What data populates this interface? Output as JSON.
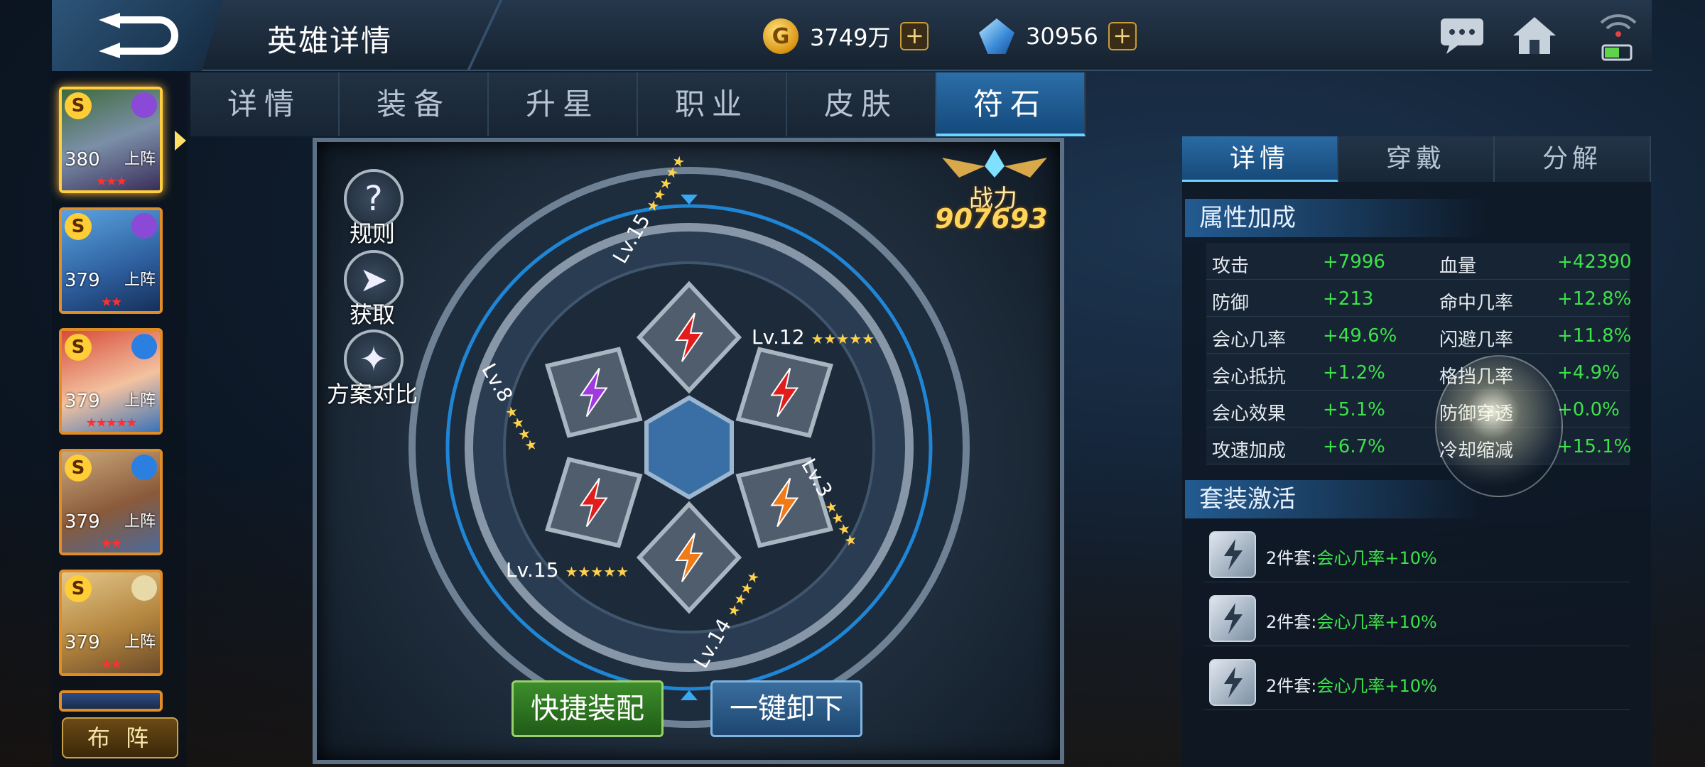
{
  "header": {
    "title": "英雄详情",
    "gold": "3749万",
    "gems": "30956"
  },
  "tabs": [
    "详情",
    "装备",
    "升星",
    "职业",
    "皮肤",
    "符石"
  ],
  "heroes": [
    {
      "grade": "S",
      "level": "380",
      "status": "上阵",
      "stars": "★★★",
      "element": "#8a49d6"
    },
    {
      "grade": "S",
      "level": "379",
      "status": "上阵",
      "stars": "★★",
      "element": "#8a49d6"
    },
    {
      "grade": "S",
      "level": "379",
      "status": "上阵",
      "stars": "★★★★★",
      "element": "#2a7fe0"
    },
    {
      "grade": "S",
      "level": "379",
      "status": "上阵",
      "stars": "★★",
      "element": "#2a7fe0"
    },
    {
      "grade": "S",
      "level": "379",
      "status": "上阵",
      "stars": "★★",
      "element": "#e8d9a8"
    }
  ],
  "formation_label": "布 阵",
  "side_buttons": {
    "rules": "规则",
    "obtain": "获取",
    "compare": "方案对比"
  },
  "power": {
    "label": "战力",
    "value": "907693"
  },
  "runes": [
    {
      "level": "Lv.15",
      "stars": "★★★★★",
      "color": "#e21b1b"
    },
    {
      "level": "Lv.12",
      "stars": "★★★★★",
      "color": "#e21b1b"
    },
    {
      "level": "Lv.3",
      "stars": "★★★★",
      "color": "#f07a18"
    },
    {
      "level": "Lv.14",
      "stars": "★★★★",
      "color": "#f07a18"
    },
    {
      "level": "Lv.15",
      "stars": "★★★★★",
      "color": "#e21b1b"
    },
    {
      "level": "Lv.8",
      "stars": "★★★★",
      "color": "#a03ae0"
    }
  ],
  "actions": {
    "quick_equip": "快捷装配",
    "unload_all": "一键卸下"
  },
  "right_tabs": [
    "详情",
    "穿戴",
    "分解"
  ],
  "attributes_title": "属性加成",
  "attributes": [
    {
      "n1": "攻击",
      "v1": "+7996",
      "n2": "血量",
      "v2": "+42390"
    },
    {
      "n1": "防御",
      "v1": "+213",
      "n2": "命中几率",
      "v2": "+12.8%"
    },
    {
      "n1": "会心几率",
      "v1": "+49.6%",
      "n2": "闪避几率",
      "v2": "+11.8%"
    },
    {
      "n1": "会心抵抗",
      "v1": "+1.2%",
      "n2": "格挡几率",
      "v2": "+4.9%"
    },
    {
      "n1": "会心效果",
      "v1": "+5.1%",
      "n2": "防御穿透",
      "v2": "+0.0%"
    },
    {
      "n1": "攻速加成",
      "v1": "+6.7%",
      "n2": "冷却缩减",
      "v2": "+15.1%"
    }
  ],
  "sets_title": "套装激活",
  "sets": [
    {
      "label": "2件套:",
      "effect": "会心几率+10%",
      "icon_count": "2"
    },
    {
      "label": "2件套:",
      "effect": "会心几率+10%",
      "icon_count": "2"
    },
    {
      "label": "2件套:",
      "effect": "会心几率+10%",
      "icon_count": "2"
    }
  ]
}
